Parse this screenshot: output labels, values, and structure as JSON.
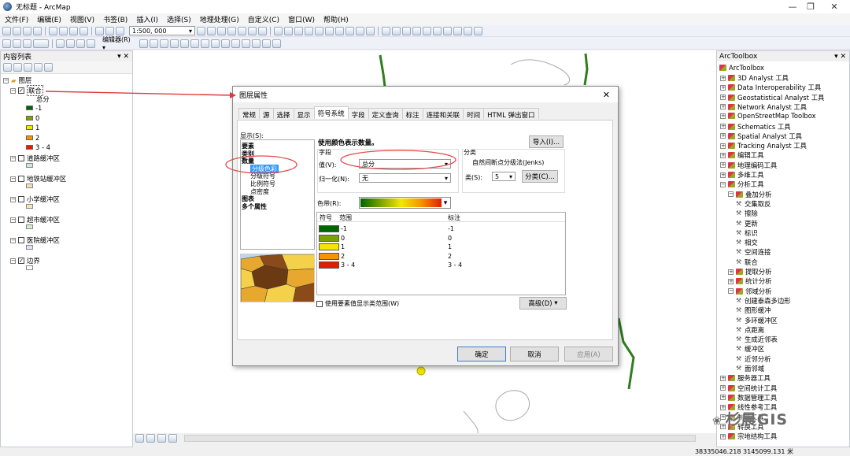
{
  "app": {
    "title": "无标题 - ArcMap"
  },
  "menu": [
    "文件(F)",
    "编辑(E)",
    "视图(V)",
    "书签(B)",
    "插入(I)",
    "选择(S)",
    "地理处理(G)",
    "自定义(C)",
    "窗口(W)",
    "帮助(H)"
  ],
  "toolbar": {
    "scale": "1:500, 000",
    "editor_label": "编辑器(R) ▾"
  },
  "toc": {
    "title": "内容列表",
    "root": "图层",
    "layer_main": "联合",
    "field_label": "总分",
    "legend": [
      {
        "label": "-1",
        "color": "#006400"
      },
      {
        "label": "0",
        "color": "#7aa300"
      },
      {
        "label": "1",
        "color": "#f5e600"
      },
      {
        "label": "2",
        "color": "#f59300"
      },
      {
        "label": "3 - 4",
        "color": "#e61c00"
      }
    ],
    "layers": [
      {
        "name": "道路缓冲区",
        "swatch": "#cfe6e6"
      },
      {
        "name": "地铁站缓冲区",
        "swatch": "#f1e0c0"
      },
      {
        "name": "小学缓冲区",
        "swatch": "#f3e7b8"
      },
      {
        "name": "超市缓冲区",
        "swatch": "#d9efc8"
      },
      {
        "name": "医院缓冲区",
        "swatch": "#dce4f5"
      },
      {
        "name": "边界",
        "swatch": "#ffffff"
      }
    ]
  },
  "dialog": {
    "title": "图层属性",
    "tabs": [
      "常规",
      "源",
      "选择",
      "显示",
      "符号系统",
      "字段",
      "定义查询",
      "标注",
      "连接和关联",
      "时间",
      "HTML 弹出窗口"
    ],
    "show_label": "显示(S):",
    "show_items": [
      "要素",
      "类别",
      "数量",
      "分级色彩",
      "分级符号",
      "比例符号",
      "点密度",
      "图表",
      "多个属性"
    ],
    "heading": "使用颜色表示数量。",
    "import": "导入(I)...",
    "field_group": "字段",
    "value_label": "值(V):",
    "value": "总分",
    "normalize_label": "归一化(N):",
    "normalize": "无",
    "class_group": "分类",
    "class_method": "自然间断点分级法(Jenks)",
    "class_count_label": "类(S):",
    "class_count": "5",
    "classify_btn": "分类(C)...",
    "ramp_label": "色带(R):",
    "cols": [
      "符号",
      "范围",
      "标注"
    ],
    "rows": [
      {
        "range": "-1",
        "label": "-1",
        "color": "#006400"
      },
      {
        "range": "0",
        "label": "0",
        "color": "#7aa300"
      },
      {
        "range": "1",
        "label": "1",
        "color": "#f5e600"
      },
      {
        "range": "2",
        "label": "2",
        "color": "#f59300"
      },
      {
        "range": "3 - 4",
        "label": "3 - 4",
        "color": "#e61c00"
      }
    ],
    "show_range_check": "使用要素值显示类范围(W)",
    "advanced": "高级(D)",
    "ok": "确定",
    "cancel": "取消",
    "apply": "应用(A)"
  },
  "arctoolbox": {
    "title": "ArcToolbox",
    "root": "ArcToolbox",
    "items": [
      {
        "t": "3D Analyst 工具",
        "l": 1,
        "k": "box"
      },
      {
        "t": "Data Interoperability 工具",
        "l": 1,
        "k": "box"
      },
      {
        "t": "Geostatistical Analyst 工具",
        "l": 1,
        "k": "box"
      },
      {
        "t": "Network Analyst 工具",
        "l": 1,
        "k": "box"
      },
      {
        "t": "OpenStreetMap Toolbox",
        "l": 1,
        "k": "box"
      },
      {
        "t": "Schematics 工具",
        "l": 1,
        "k": "box"
      },
      {
        "t": "Spatial Analyst 工具",
        "l": 1,
        "k": "box"
      },
      {
        "t": "Tracking Analyst 工具",
        "l": 1,
        "k": "box"
      },
      {
        "t": "编辑工具",
        "l": 1,
        "k": "box"
      },
      {
        "t": "地理编码工具",
        "l": 1,
        "k": "box"
      },
      {
        "t": "多维工具",
        "l": 1,
        "k": "box"
      },
      {
        "t": "分析工具",
        "l": 1,
        "k": "box",
        "open": true
      },
      {
        "t": "叠加分析",
        "l": 2,
        "k": "box",
        "open": true
      },
      {
        "t": "交集取反",
        "l": 3,
        "k": "tool"
      },
      {
        "t": "擦除",
        "l": 3,
        "k": "tool"
      },
      {
        "t": "更新",
        "l": 3,
        "k": "tool"
      },
      {
        "t": "标识",
        "l": 3,
        "k": "tool"
      },
      {
        "t": "相交",
        "l": 3,
        "k": "tool"
      },
      {
        "t": "空间连接",
        "l": 3,
        "k": "tool"
      },
      {
        "t": "联合",
        "l": 3,
        "k": "tool"
      },
      {
        "t": "提取分析",
        "l": 2,
        "k": "box"
      },
      {
        "t": "统计分析",
        "l": 2,
        "k": "box"
      },
      {
        "t": "邻域分析",
        "l": 2,
        "k": "box",
        "open": true
      },
      {
        "t": "创建泰森多边形",
        "l": 3,
        "k": "tool"
      },
      {
        "t": "图形缓冲",
        "l": 3,
        "k": "tool"
      },
      {
        "t": "多环缓冲区",
        "l": 3,
        "k": "tool"
      },
      {
        "t": "点距离",
        "l": 3,
        "k": "tool"
      },
      {
        "t": "生成近邻表",
        "l": 3,
        "k": "tool"
      },
      {
        "t": "缓冲区",
        "l": 3,
        "k": "tool"
      },
      {
        "t": "近邻分析",
        "l": 3,
        "k": "tool"
      },
      {
        "t": "面邻域",
        "l": 3,
        "k": "tool"
      },
      {
        "t": "服务器工具",
        "l": 1,
        "k": "box"
      },
      {
        "t": "空间统计工具",
        "l": 1,
        "k": "box"
      },
      {
        "t": "数据管理工具",
        "l": 1,
        "k": "box"
      },
      {
        "t": "线性参考工具",
        "l": 1,
        "k": "box"
      },
      {
        "t": "制图工具",
        "l": 1,
        "k": "box"
      },
      {
        "t": "转换工具",
        "l": 1,
        "k": "box"
      },
      {
        "t": "宗地结构工具",
        "l": 1,
        "k": "box"
      }
    ]
  },
  "watermark": "杉晨GIS",
  "status": {
    "coords": "38335046.218  3145099.131 米"
  }
}
